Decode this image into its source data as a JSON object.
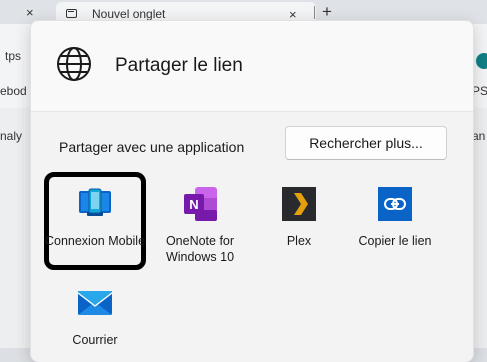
{
  "browser": {
    "tab_close_glyph": "×",
    "tab_title": "Nouvel onglet",
    "new_tab_glyph": "+",
    "toolbar_fragments": {
      "address_left": "tps",
      "bookmark_left": "ebod",
      "bookmark_right": "PS",
      "content_left": "naly",
      "content_right": "an"
    }
  },
  "share": {
    "title": "Partager le lien",
    "section_label": "Partager avec une application",
    "search_more": "Rechercher plus...",
    "apps": [
      {
        "label": "Connexion Mobile",
        "icon": "phone-link-icon",
        "selected": true
      },
      {
        "label": "OneNote for Windows 10",
        "icon": "onenote-icon",
        "selected": false
      },
      {
        "label": "Plex",
        "icon": "plex-icon",
        "selected": false
      },
      {
        "label": "Copier le lien",
        "icon": "copy-link-icon",
        "selected": false
      },
      {
        "label": "Courrier",
        "icon": "mail-icon",
        "selected": false
      }
    ]
  },
  "colors": {
    "accent_blue": "#0a64c8",
    "onenote_purple": "#7719aa",
    "plex_orange": "#e5a00d",
    "profile_teal": "#0f7f86"
  }
}
